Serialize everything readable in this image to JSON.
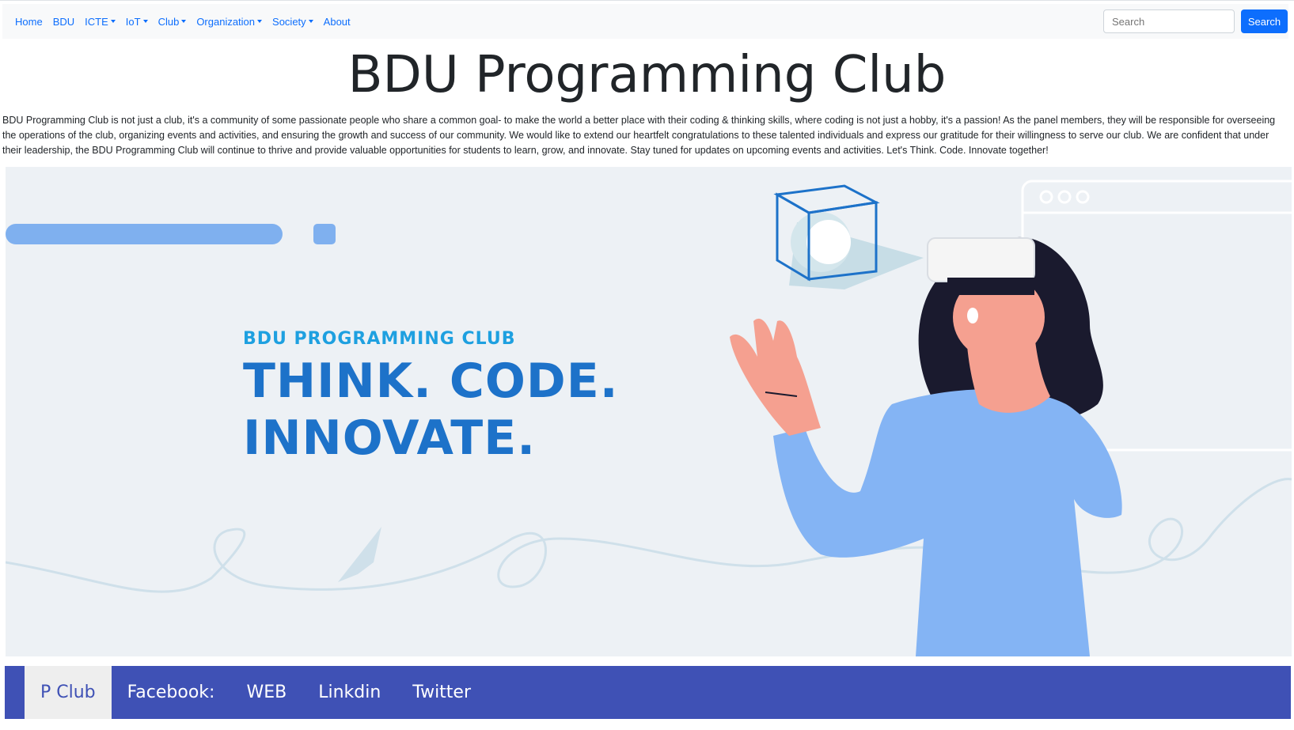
{
  "nav": {
    "items": [
      {
        "label": "Home",
        "dropdown": false
      },
      {
        "label": "BDU",
        "dropdown": false
      },
      {
        "label": "ICTE",
        "dropdown": true
      },
      {
        "label": "IoT",
        "dropdown": true
      },
      {
        "label": "Club",
        "dropdown": true
      },
      {
        "label": "Organization",
        "dropdown": true
      },
      {
        "label": "Society",
        "dropdown": true
      },
      {
        "label": "About",
        "dropdown": false
      }
    ],
    "search_placeholder": "Search",
    "search_button": "Search"
  },
  "page": {
    "title": "BDU Programming Club",
    "intro": "BDU Programming Club is not just a club, it's a community of some passionate people who share a common goal- to make the world a better place with their coding & thinking skills, where coding is not just a hobby, it's a passion! As the panel members, they will be responsible for overseeing the operations of the club, organizing events and activities, and ensuring the growth and success of our community. We would like to extend our heartfelt congratulations to these talented individuals and express our gratitude for their willingness to serve our club. We are confident that under their leadership, the BDU Programming Club will continue to thrive and provide valuable opportunities for students to learn, grow, and innovate. Stay tuned for updates on upcoming events and activities. Let's Think. Code. Innovate together!"
  },
  "hero": {
    "subtitle": "BDU PROGRAMMING CLUB",
    "headline_line1": "THINK. CODE.",
    "headline_line2": "INNOVATE.",
    "colors": {
      "background": "#edf1f5",
      "accent": "#1d72c9",
      "sub": "#1ea0e0",
      "shirt": "#84b4f4",
      "skin": "#f5a090",
      "hair": "#1a1a2e"
    }
  },
  "footer": {
    "items": [
      "P Club",
      "Facebook:",
      "WEB",
      "Linkdin",
      "Twitter"
    ],
    "active_index": 0,
    "color": "#3f51b5"
  }
}
